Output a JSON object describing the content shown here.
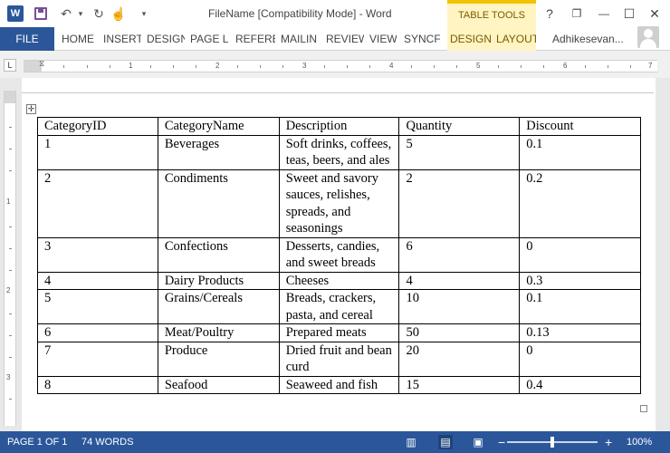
{
  "titlebar": {
    "app_icon": "word-logo-icon",
    "app_letter": "W",
    "save": "save-icon",
    "undo_glyph": "↶",
    "undo_arrow_glyph": "▾",
    "redo_glyph": "↻",
    "touch_glyph": "☝",
    "customize_glyph": "▾",
    "title": "FileName [Compatibility Mode] - Word",
    "context_group": "TABLE TOOLS",
    "help": "?",
    "restore_glyph": "❐",
    "minimize_glyph": "—",
    "maximize_glyph": "☐",
    "close_glyph": "✕"
  },
  "ribbon": {
    "file": "FILE",
    "tabs": [
      "HOME",
      "INSERT",
      "DESIGN",
      "PAGE L",
      "REFERE",
      "MAILIN",
      "REVIEW",
      "VIEW",
      "SYNCF"
    ],
    "context_tabs": [
      "DESIGN",
      "LAYOUT"
    ],
    "account": "Adhikesevan..."
  },
  "ruler": {
    "tab_selector": "L",
    "numbers": [
      "1",
      "2",
      "3",
      "4",
      "5",
      "6",
      "7"
    ],
    "vertical_numbers": [
      "1",
      "2",
      "3"
    ]
  },
  "table": {
    "headers": [
      "CategoryID",
      "CategoryName",
      "Description",
      "Quantity",
      "Discount"
    ],
    "rows": [
      [
        "1",
        "Beverages",
        "Soft drinks, coffees, teas, beers, and ales",
        "5",
        "0.1"
      ],
      [
        "2",
        "Condiments",
        "Sweet and savory sauces, relishes, spreads, and seasonings",
        "2",
        "0.2"
      ],
      [
        "3",
        "Confections",
        "Desserts, candies, and sweet breads",
        "6",
        "0"
      ],
      [
        "4",
        "Dairy Products",
        "Cheeses",
        "4",
        "0.3"
      ],
      [
        "5",
        "Grains/Cereals",
        "Breads, crackers, pasta, and cereal",
        "10",
        "0.1"
      ],
      [
        "6",
        "Meat/Poultry",
        "Prepared meats",
        "50",
        "0.13"
      ],
      [
        "7",
        "Produce",
        "Dried fruit and bean curd",
        "20",
        "0"
      ],
      [
        "8",
        "Seafood",
        "Seaweed and fish",
        "15",
        "0.4"
      ]
    ]
  },
  "statusbar": {
    "page": "PAGE 1 OF 1",
    "words": "74 WORDS",
    "zoom_out": "−",
    "zoom_in": "+",
    "zoom": "100%",
    "zoom_level_percent": 100
  }
}
